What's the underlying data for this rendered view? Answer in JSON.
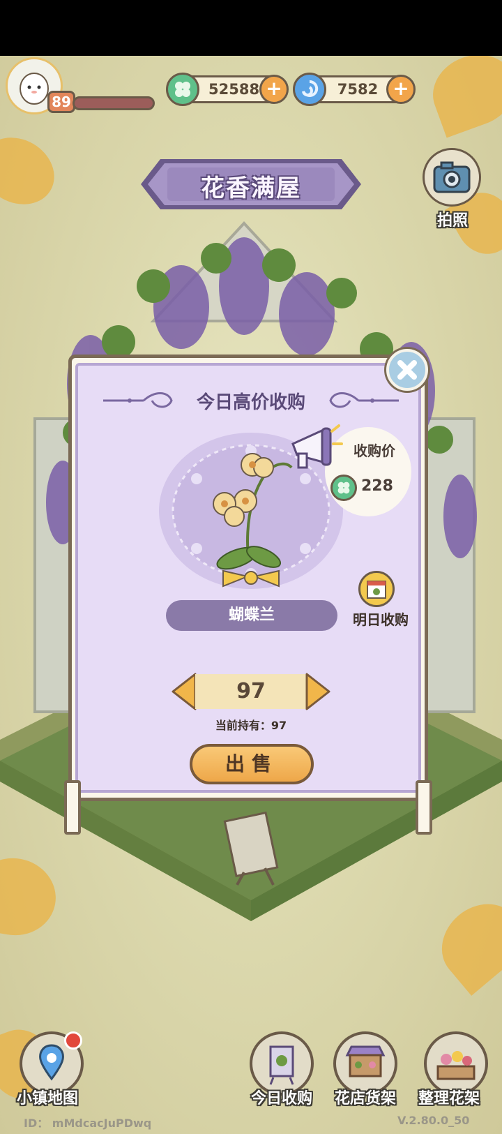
{
  "player": {
    "level": "89"
  },
  "currencies": [
    {
      "icon": "clover-coin-icon",
      "value": "52588"
    },
    {
      "icon": "blue-swirl-gem-icon",
      "value": "7582"
    }
  ],
  "header": {
    "title": "花香满屋",
    "camera_label": "拍照"
  },
  "panel": {
    "title": "今日高价收购",
    "price_label": "收购价",
    "price_value": "228",
    "flower_name": "蝴蝶兰",
    "tomorrow_label": "明日收购",
    "quantity": "97",
    "held_label": "当前持有：97",
    "sell_label": "出售"
  },
  "bottom_nav": [
    {
      "label": "小镇地图",
      "icon": "map-pin-icon"
    },
    {
      "label": "今日收购",
      "icon": "daily-purchase-icon"
    },
    {
      "label": "花店货架",
      "icon": "shop-stall-icon"
    },
    {
      "label": "整理花架",
      "icon": "flower-shelf-icon"
    }
  ],
  "footer": {
    "user_id": "ID： mMdcacJuPDwq",
    "version": "V.2.80.0_50"
  },
  "colors": {
    "accent_purple": "#8a7aa8",
    "sell_orange": "#eea749",
    "panel_lilac": "#e7dcf6"
  }
}
